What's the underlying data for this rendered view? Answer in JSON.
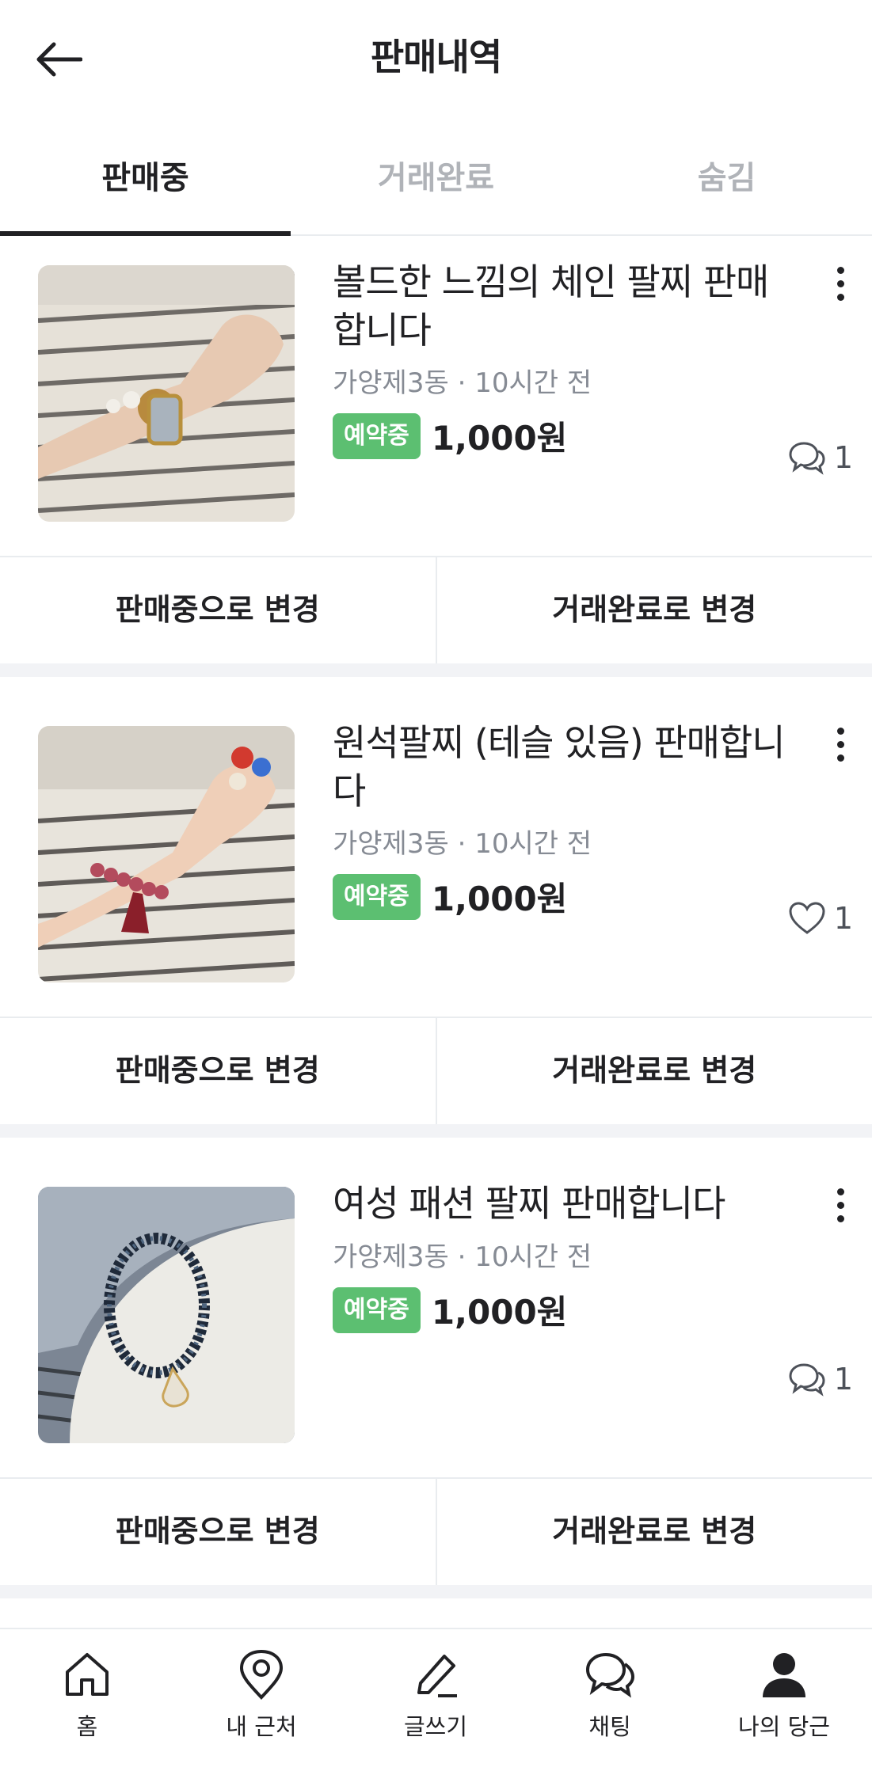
{
  "header": {
    "title": "판매내역",
    "back_icon": "arrow-left-icon"
  },
  "tabs": [
    {
      "label": "판매중",
      "active": true
    },
    {
      "label": "거래완료",
      "active": false
    },
    {
      "label": "숨김",
      "active": false
    }
  ],
  "items": [
    {
      "title": "볼드한 느낌의 체인 팔찌 판매합니다",
      "location": "가양제3동",
      "time": "10시간 전",
      "status": "예약중",
      "price": "1,000원",
      "stat_icon": "chat-bubbles-icon",
      "stat_count": "1",
      "action_left": "판매중으로 변경",
      "action_right": "거래완료로 변경"
    },
    {
      "title": "원석팔찌 (테슬 있음) 판매합니다",
      "location": "가양제3동",
      "time": "10시간 전",
      "status": "예약중",
      "price": "1,000원",
      "stat_icon": "heart-icon",
      "stat_count": "1",
      "action_left": "판매중으로 변경",
      "action_right": "거래완료로 변경"
    },
    {
      "title": "여성 패션 팔찌 판매합니다",
      "location": "가양제3동",
      "time": "10시간 전",
      "status": "예약중",
      "price": "1,000원",
      "stat_icon": "chat-bubbles-icon",
      "stat_count": "1",
      "action_left": "판매중으로 변경",
      "action_right": "거래완료로 변경"
    }
  ],
  "meta_separator": "·",
  "bottom_nav": [
    {
      "label": "홈",
      "icon": "home-icon"
    },
    {
      "label": "내 근처",
      "icon": "location-pin-icon"
    },
    {
      "label": "글쓰기",
      "icon": "pencil-icon"
    },
    {
      "label": "채팅",
      "icon": "chat-bubbles-icon"
    },
    {
      "label": "나의 당근",
      "icon": "person-icon"
    }
  ],
  "colors": {
    "badge": "#5cbf71",
    "text": "#212124",
    "muted": "#868b94",
    "divider": "#e9ecef"
  }
}
